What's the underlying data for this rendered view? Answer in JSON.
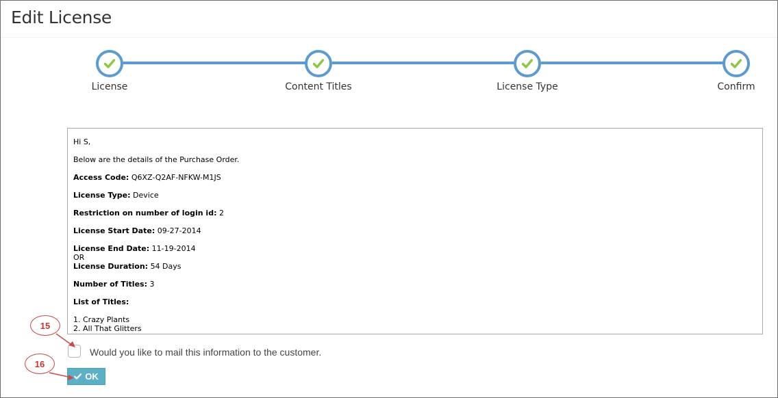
{
  "page": {
    "title": "Edit License"
  },
  "stepper": {
    "steps": [
      {
        "label": "License",
        "done": true
      },
      {
        "label": "Content Titles",
        "done": true
      },
      {
        "label": "License Type",
        "done": true
      },
      {
        "label": "Confirm",
        "done": true
      }
    ]
  },
  "message": {
    "greeting": "Hi S,",
    "intro": "Below are the details of the Purchase Order.",
    "access_code_label": "Access Code:",
    "access_code": "Q6XZ-Q2AF-NFKW-M1JS",
    "license_type_label": "License Type:",
    "license_type": "Device",
    "restriction_label": "Restriction on number of login id:",
    "restriction": "2",
    "start_label": "License Start Date:",
    "start": "09-27-2014",
    "end_label": "License End Date:",
    "end": "11-19-2014",
    "or": "OR",
    "duration_label": "License Duration:",
    "duration": "54 Days",
    "num_titles_label": "Number of Titles:",
    "num_titles": "3",
    "list_label": "List of Titles:",
    "titles": [
      "1. Crazy Plants",
      "2. All That Glitters"
    ]
  },
  "mail_option": {
    "label": "Would you like to mail this information to the customer.",
    "checked": false
  },
  "ok_button": {
    "label": "OK"
  },
  "callouts": {
    "c15": "15",
    "c16": "16"
  },
  "colors": {
    "step_accent": "#5b9bcf",
    "check_green": "#8dc63f",
    "button": "#5bb0c5",
    "callout_red": "#c84c4c"
  }
}
